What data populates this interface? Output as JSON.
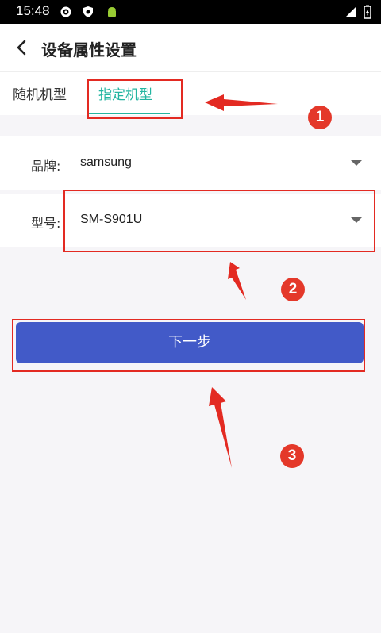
{
  "status_bar": {
    "time": "15:48",
    "icons": [
      "gear-icon",
      "shield-icon",
      "android-icon",
      "signal-icon",
      "battery-icon"
    ]
  },
  "header": {
    "title": "设备属性设置",
    "back_icon": "back-arrow-icon"
  },
  "tabs": [
    {
      "label": "随机机型",
      "active": false
    },
    {
      "label": "指定机型",
      "active": true
    }
  ],
  "form": {
    "brand": {
      "label": "品牌:",
      "value": "samsung"
    },
    "model": {
      "label": "型号:",
      "value": "SM-S901U"
    }
  },
  "next_button": {
    "label": "下一步"
  },
  "annotations": {
    "badges": [
      "1",
      "2",
      "3"
    ]
  },
  "colors": {
    "accent": "#23b5a1",
    "button": "#425ac8",
    "annotation": "#e32a22"
  }
}
